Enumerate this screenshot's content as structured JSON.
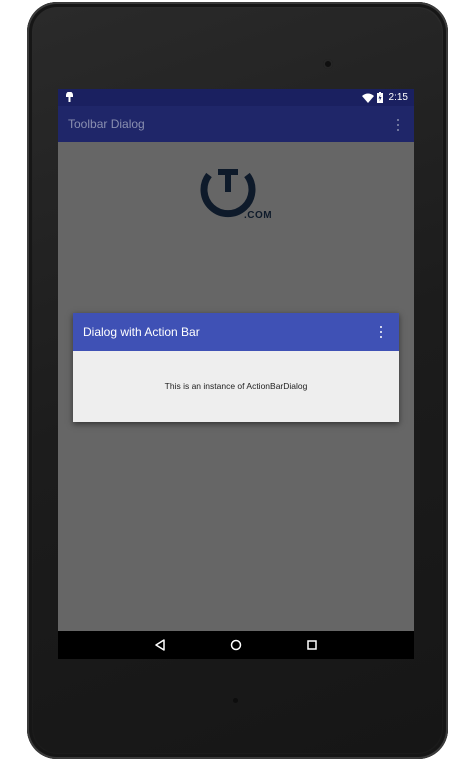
{
  "status_bar": {
    "time": "2:15",
    "icons": [
      "android-debug-icon",
      "wifi-icon",
      "battery-charging-icon"
    ]
  },
  "toolbar": {
    "title": "Toolbar Dialog",
    "overflow_icon": "more-vert-icon"
  },
  "logo": {
    "suffix": ".COM"
  },
  "dialog": {
    "title": "Dialog with Action Bar",
    "overflow_icon": "more-vert-icon",
    "message": "This is an instance of ActionBarDialog"
  },
  "nav_bar": {
    "icons": [
      "back-icon",
      "home-icon",
      "recents-icon"
    ]
  },
  "colors": {
    "status_bar": "#1a2060",
    "toolbar": "#1f2669",
    "screen_dim": "#666666",
    "dialog_bar": "#3f51b5",
    "dialog_body": "#eeeeee"
  }
}
